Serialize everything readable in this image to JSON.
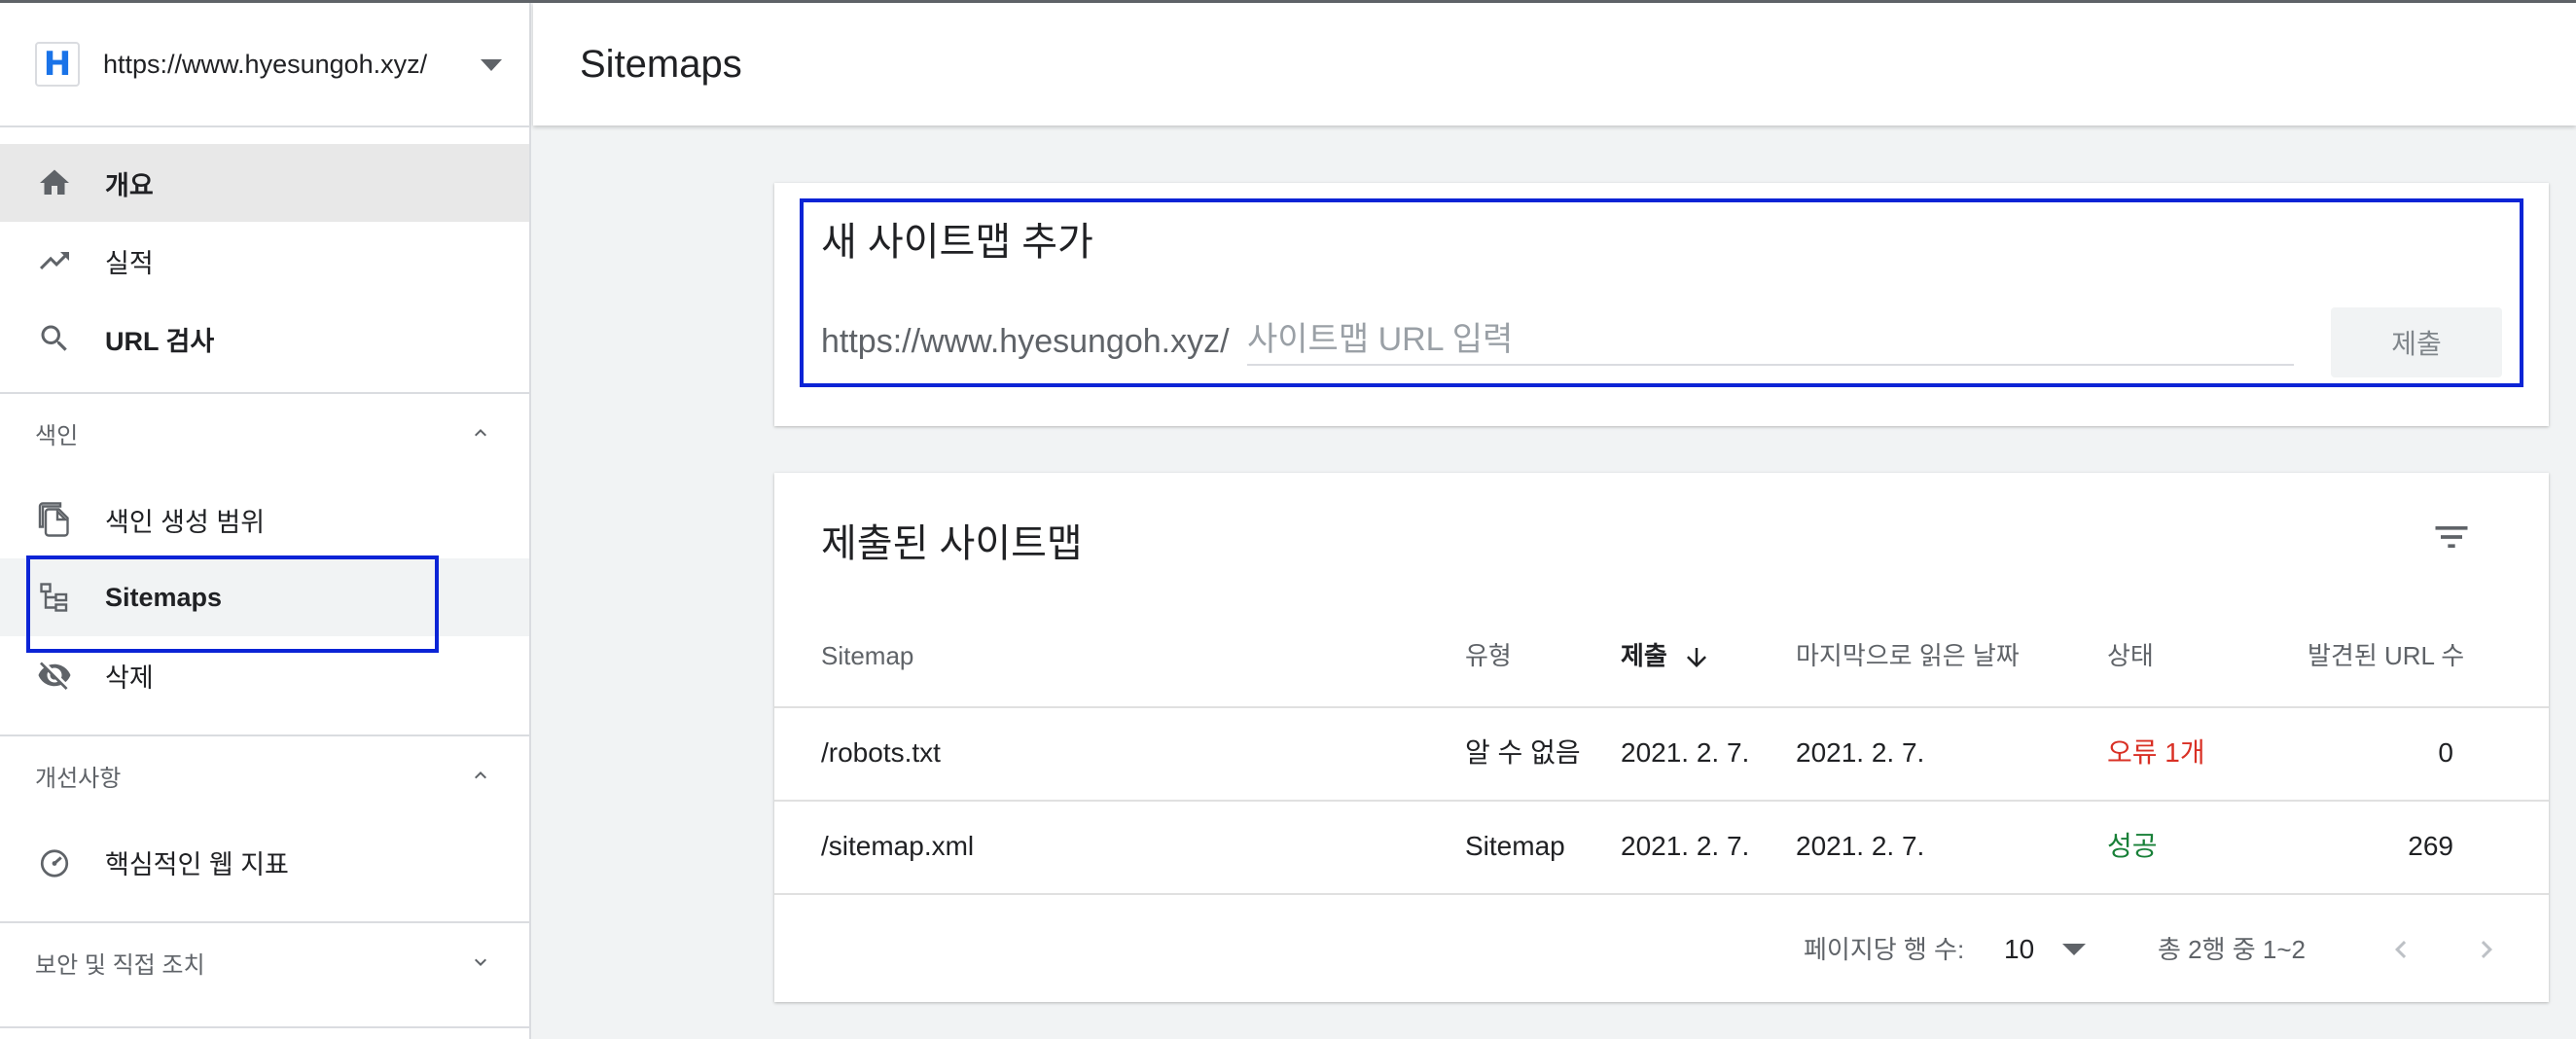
{
  "property": {
    "logo": "H",
    "url": "https://www.hyesungoh.xyz/"
  },
  "nav": {
    "overview": "개요",
    "performance": "실적",
    "url_inspection": "URL 검사",
    "index_section": "색인",
    "coverage": "색인 생성 범위",
    "sitemaps": "Sitemaps",
    "removals": "삭제",
    "enhancements_section": "개선사항",
    "core_web_vitals": "핵심적인 웹 지표",
    "security_section": "보안 및 직접 조치"
  },
  "header": {
    "title": "Sitemaps"
  },
  "add_sitemap": {
    "title": "새 사이트맵 추가",
    "prefix": "https://www.hyesungoh.xyz/",
    "placeholder": "사이트맵 URL 입력",
    "submit_label": "제출"
  },
  "submitted": {
    "title": "제출된 사이트맵",
    "columns": {
      "sitemap": "Sitemap",
      "type": "유형",
      "submitted": "제출",
      "last_read": "마지막으로 읽은 날짜",
      "status": "상태",
      "discovered": "발견된 URL 수"
    },
    "rows": [
      {
        "sitemap": "/robots.txt",
        "type": "알 수 없음",
        "submitted": "2021. 2. 7.",
        "last_read": "2021. 2. 7.",
        "status": "오류 1개",
        "discovered": "0"
      },
      {
        "sitemap": "/sitemap.xml",
        "type": "Sitemap",
        "submitted": "2021. 2. 7.",
        "last_read": "2021. 2. 7.",
        "status": "성공",
        "discovered": "269"
      }
    ],
    "pagination": {
      "rows_per_page_label": "페이지당 행 수:",
      "rows_per_page": "10",
      "range": "총 2행 중 1~2"
    }
  },
  "colors": {
    "highlight": "#0b24d6",
    "error": "#d93025",
    "success": "#188038",
    "accent": "#1a73e8"
  }
}
